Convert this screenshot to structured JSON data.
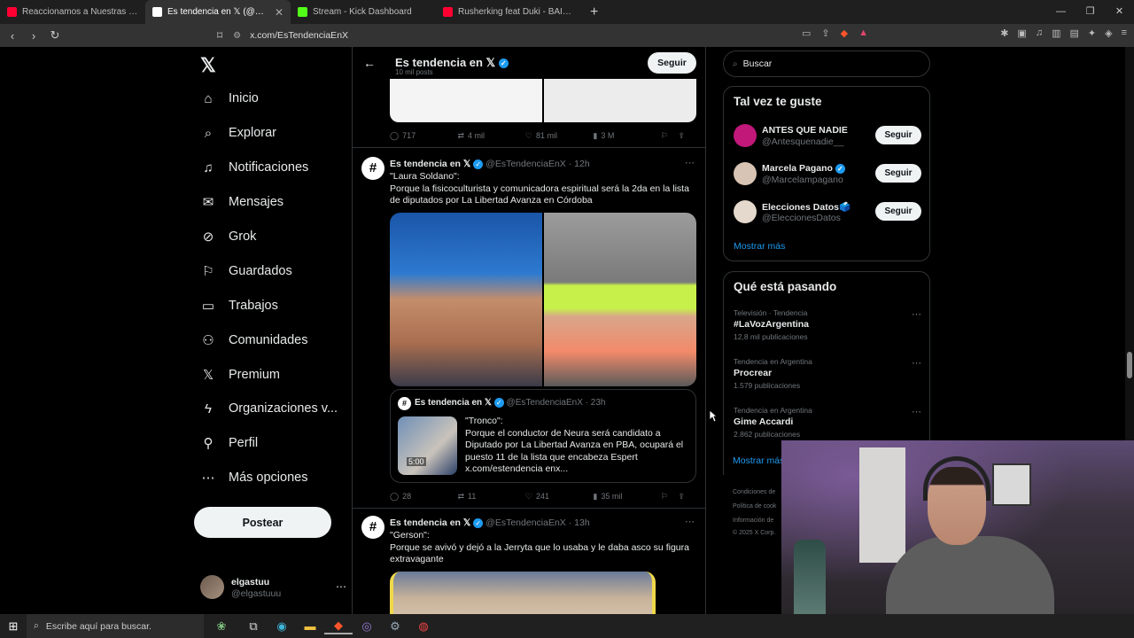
{
  "browser": {
    "tabs": [
      {
        "label": "Reaccionamos a Nuestras Historias V",
        "favicon_color": "#ff0033",
        "active": false
      },
      {
        "label": "Es tendencia en 𝕏 (@EsTendenci",
        "favicon_color": "#ffffff",
        "active": true
      },
      {
        "label": "Stream - Kick Dashboard",
        "favicon_color": "#53fc18",
        "active": false
      },
      {
        "label": "Rusherking feat Duki - BAILANDO TE",
        "favicon_color": "#ff0033",
        "active": false
      }
    ],
    "url": "x.com/EsTendenciaEnX"
  },
  "nav": {
    "items": [
      {
        "label": "Inicio",
        "icon": "home-icon"
      },
      {
        "label": "Explorar",
        "icon": "search-icon"
      },
      {
        "label": "Notificaciones",
        "icon": "bell-icon"
      },
      {
        "label": "Mensajes",
        "icon": "mail-icon"
      },
      {
        "label": "Grok",
        "icon": "grok-icon"
      },
      {
        "label": "Guardados",
        "icon": "bookmark-icon"
      },
      {
        "label": "Trabajos",
        "icon": "briefcase-icon"
      },
      {
        "label": "Comunidades",
        "icon": "people-icon"
      },
      {
        "label": "Premium",
        "icon": "x-icon"
      },
      {
        "label": "Organizaciones v...",
        "icon": "lightning-icon"
      },
      {
        "label": "Perfil",
        "icon": "person-icon"
      },
      {
        "label": "Más opciones",
        "icon": "more-circle-icon"
      }
    ],
    "post_label": "Postear",
    "profile": {
      "name": "elgastuu",
      "handle": "@elgastuuu"
    }
  },
  "header": {
    "title": "Es tendencia en 𝕏",
    "subtitle": "10 mil posts",
    "follow_label": "Seguir"
  },
  "posts": [
    {
      "stats": {
        "replies": "717",
        "reposts": "4 mil",
        "likes": "81 mil",
        "views": "3 M"
      }
    },
    {
      "author": "Es tendencia en 𝕏",
      "handle": "@EsTendenciaEnX",
      "time": "12h",
      "text_title": "\"Laura Soldano\":",
      "text_body": "Porque la fisicoculturista y comunicadora espiritual será la 2da en la lista de diputados por La Libertad Avanza en Córdoba",
      "quote": {
        "author": "Es tendencia en 𝕏",
        "handle": "@EsTendenciaEnX",
        "time": "23h",
        "duration": "5:00",
        "text": "\"Tronco\":\nPorque el conductor de Neura será candidato a Diputado por La Libertad Avanza en PBA, ocupará el puesto 11 de la lista que encabeza Espert x.com/estendencia enx..."
      },
      "stats": {
        "replies": "28",
        "reposts": "11",
        "likes": "241",
        "views": "35 mil"
      }
    },
    {
      "author": "Es tendencia en 𝕏",
      "handle": "@EsTendenciaEnX",
      "time": "13h",
      "text_title": "\"Gerson\":",
      "text_body": "Porque se avivó y dejó a la Jerryta que lo usaba y le daba asco su figura extravagante"
    }
  ],
  "right": {
    "search_placeholder": "Buscar",
    "who_title": "Tal vez te guste",
    "who": [
      {
        "name": "ANTES QUE NADIE",
        "handle": "@Antesquenadie__",
        "verified": false,
        "avatar_color": "#c2187a",
        "follow": "Seguir"
      },
      {
        "name": "Marcela Pagano",
        "handle": "@Marcelampagano",
        "verified": true,
        "avatar_color": "#d8c4b4",
        "follow": "Seguir"
      },
      {
        "name": "Elecciones Datos🗳️",
        "handle": "@EleccionesDatos",
        "verified": false,
        "avatar_color": "#e4d9cc",
        "follow": "Seguir"
      }
    ],
    "show_more": "Mostrar más",
    "trends_title": "Qué está pasando",
    "trends": [
      {
        "context": "Televisión · Tendencia",
        "name": "#LaVozArgentina",
        "posts": "12,8 mil publicaciones"
      },
      {
        "context": "Tendencia en Argentina",
        "name": "Procrear",
        "posts": "1.579 publicaciones"
      },
      {
        "context": "Tendencia en Argentina",
        "name": "Gime Accardi",
        "posts": "2.862 publicaciones"
      }
    ],
    "trends_show_more": "Mostrar más",
    "footer": [
      "Condiciones de",
      "Política de cook",
      "Información de",
      "© 2025 X Corp."
    ]
  },
  "taskbar": {
    "search_placeholder": "Escribe aquí para buscar."
  }
}
